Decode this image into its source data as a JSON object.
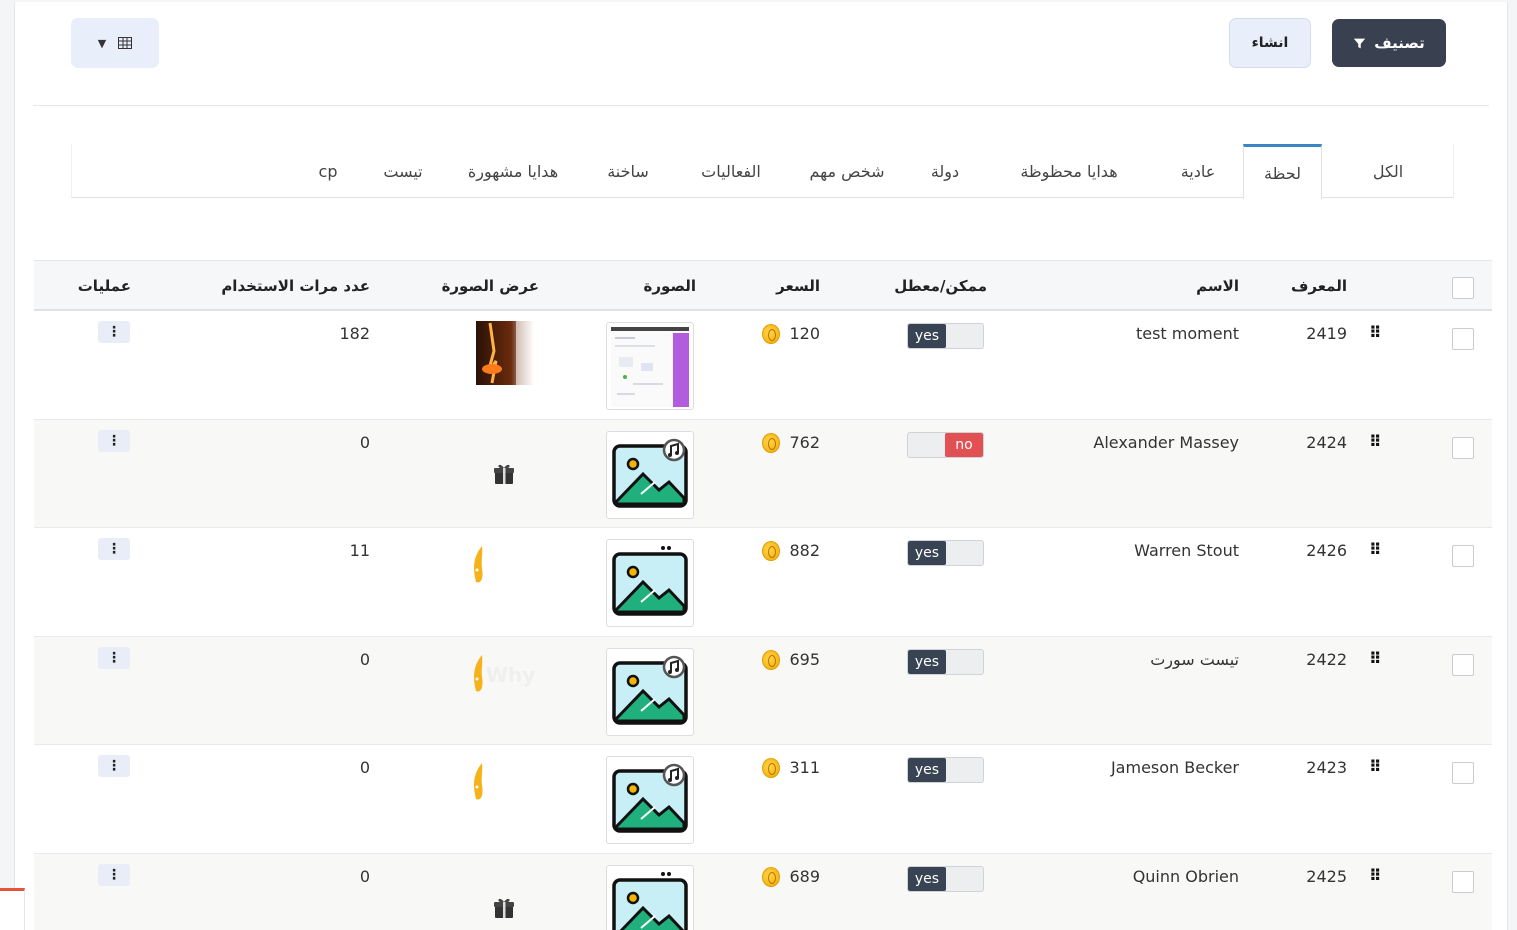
{
  "toolbar": {
    "filter_label": "تصنيف",
    "create_label": "انشاء"
  },
  "tabs": [
    "الكل",
    "لحظة",
    "عادية",
    "هدايا محظوظة",
    "دولة",
    "شخص مهم",
    "الفعاليات",
    "ساخنة",
    "هدايا مشهورة",
    "تيست",
    "cp"
  ],
  "active_tab": "لحظة",
  "table": {
    "headers": {
      "id": "المعرف",
      "name": "الاسم",
      "status": "ممكن/معطل",
      "price": "السعر",
      "image": "الصورة",
      "preview": "عرض الصورة",
      "usage": "عدد مرات الاستخدام",
      "actions": "عمليات"
    },
    "rows": [
      {
        "id": "2419",
        "name": "test moment",
        "status": "yes",
        "price": "120",
        "usage": "182",
        "image": "screenshot",
        "preview": "fire"
      },
      {
        "id": "2424",
        "name": "Alexander Massey",
        "status": "no",
        "price": "762",
        "usage": "0",
        "image": "placeholder-music",
        "preview": "gift"
      },
      {
        "id": "2426",
        "name": "Warren Stout",
        "status": "yes",
        "price": "882",
        "usage": "11",
        "image": "placeholder",
        "preview": "flame"
      },
      {
        "id": "2422",
        "name": "تيست سورت",
        "status": "yes",
        "price": "695",
        "usage": "0",
        "image": "placeholder-music",
        "preview": "flame-why"
      },
      {
        "id": "2423",
        "name": "Jameson Becker",
        "status": "yes",
        "price": "311",
        "usage": "0",
        "image": "placeholder-music",
        "preview": "flame"
      },
      {
        "id": "2425",
        "name": "Quinn Obrien",
        "status": "yes",
        "price": "689",
        "usage": "0",
        "image": "placeholder",
        "preview": "gift"
      }
    ]
  },
  "preview_overlay_text": "Why",
  "colors": {
    "primary_dark": "#394150",
    "toggle_yes": "#384353",
    "toggle_no": "#e15053",
    "tab_active": "#3d86c6",
    "coin": "#f2a900"
  }
}
